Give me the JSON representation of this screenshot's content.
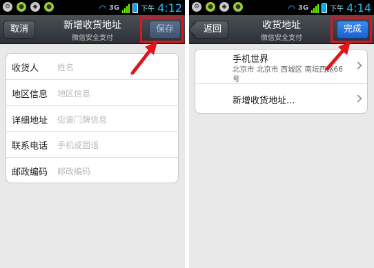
{
  "left_screen": {
    "status": {
      "ampm": "下午",
      "time": "4:12",
      "network": "3G"
    },
    "titlebar": {
      "title": "新增收货地址",
      "subtitle": "微信安全支付",
      "cancel_label": "取消",
      "save_label": "保存"
    },
    "form": {
      "rows": [
        {
          "label": "收货人",
          "placeholder": "姓名"
        },
        {
          "label": "地区信息",
          "placeholder": "地区信息"
        },
        {
          "label": "详细地址",
          "placeholder": "街道门牌信息"
        },
        {
          "label": "联系电话",
          "placeholder": "手机或固话"
        },
        {
          "label": "邮政编码",
          "placeholder": "邮政编码"
        }
      ]
    }
  },
  "right_screen": {
    "status": {
      "ampm": "下午",
      "time": "4:14",
      "network": "3G"
    },
    "titlebar": {
      "title": "收货地址",
      "subtitle": "微信安全支付",
      "back_label": "返回",
      "done_label": "完成"
    },
    "address_list": {
      "saved": {
        "name": "手机世界",
        "detail": "北京市 北京市 西城区 南坛西路66号"
      },
      "new_label": "新增收货地址..."
    }
  },
  "colors": {
    "highlight_box": "#e1141b",
    "done_button": "#1a5fd1",
    "titlebar": "#3a3e44"
  }
}
